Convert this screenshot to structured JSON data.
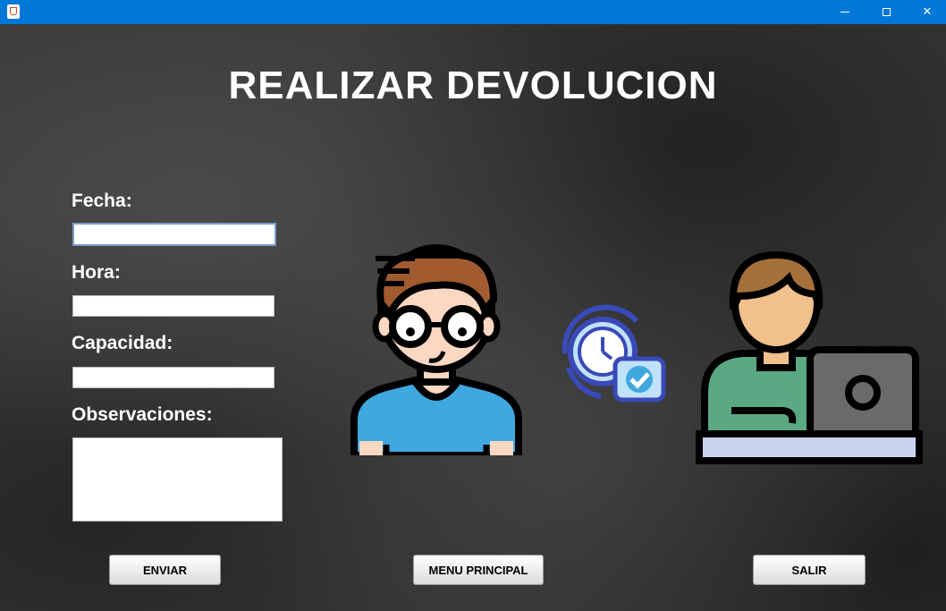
{
  "window": {
    "app_icon": "java-cup-icon",
    "controls": [
      "minimize-icon",
      "maximize-icon",
      "close-icon"
    ]
  },
  "heading": "REALIZAR DEVOLUCION",
  "form": {
    "fecha_label": "Fecha:",
    "fecha_value": "",
    "hora_label": "Hora:",
    "hora_value": "",
    "capacidad_label": "Capacidad:",
    "capacidad_value": "",
    "observaciones_label": "Observaciones:",
    "observaciones_value": ""
  },
  "buttons": {
    "enviar": "ENVIAR",
    "menu_principal": "MENU PRINCIPAL",
    "salir": "SALIR"
  },
  "illustrations": [
    "student-avatar-icon",
    "clock-check-icon",
    "laptop-worker-icon"
  ],
  "colors": {
    "titlebar": "#0078d7",
    "background": "#383838",
    "accent_blue": "#3fa8e0",
    "shirt_green": "#5aa983"
  }
}
